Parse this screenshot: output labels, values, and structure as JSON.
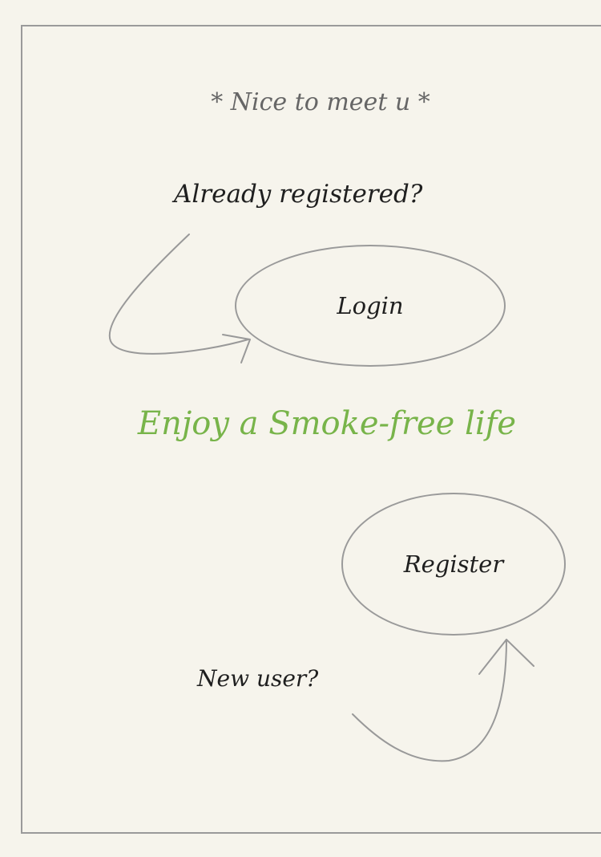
{
  "greeting": "* Nice to meet u *",
  "login_prompt": "Already registered?",
  "login_button": "Login",
  "tagline": "Enjoy a Smoke-free life",
  "register_button": "Register",
  "register_prompt": "New user?",
  "colors": {
    "background": "#f6f4ec",
    "frame": "#9a9a9a",
    "tagline": "#78b44a",
    "ink": "#1f1f1f",
    "muted": "#666666"
  }
}
